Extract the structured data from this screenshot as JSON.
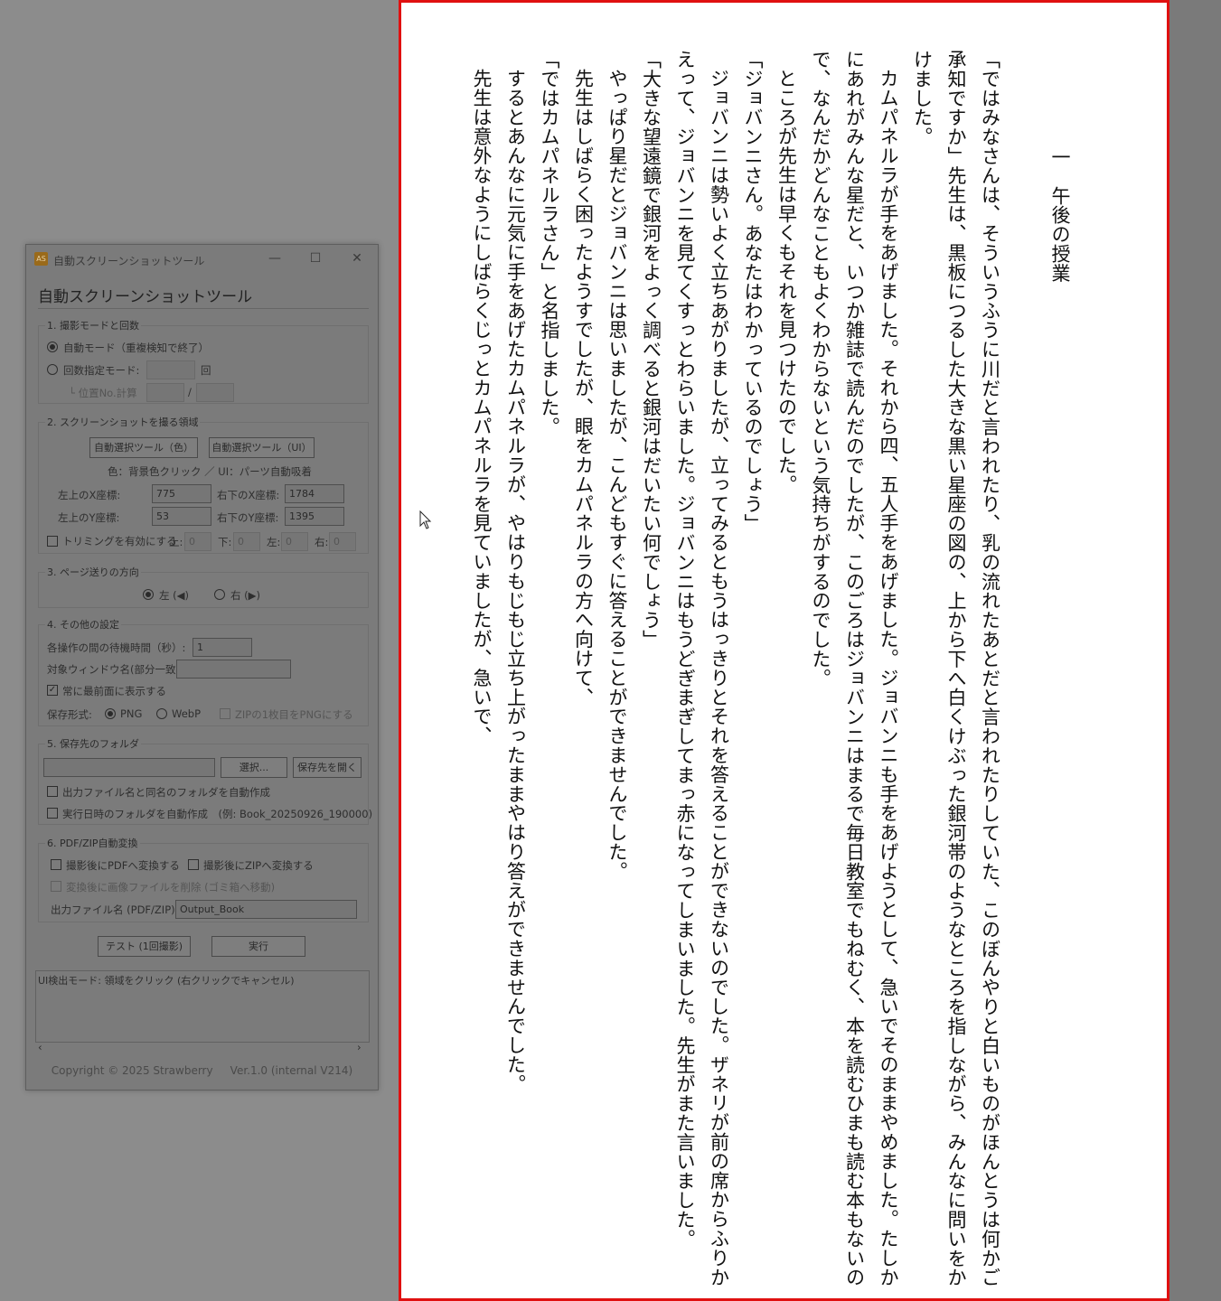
{
  "page": {
    "chapter_title": "一　午後の授業",
    "paragraphs": [
      "「ではみなさんは、そういうふうに川だと言われたり、乳の流れたあとだと言われたりしていた、このぼんやりと白いものがほんとうは何かご承知ですか」先生は、黒板につるした大きな黒い星座の図の、上から下へ白くけぶった銀河帯のようなところを指しながら、みんなに問いをかけました。",
      "カムパネルラが手をあげました。それから四、五人手をあげました。ジョバンニも手をあげようとして、急いでそのままやめました。たしかにあれがみんな星だと、いつか雑誌で読んだのでしたが、このごろはジョバンニはまるで毎日教室でもねむく、本を読むひまも読む本もないので、なんだかどんなこともよくわからないという気持ちがするのでした。",
      "ところが先生は早くもそれを見つけたのでした。",
      "「ジョバンニさん。あなたはわかっているのでしょう」",
      "ジョバンニは勢いよく立ちあがりましたが、立ってみるともうはっきりとそれを答えることができないのでした。ザネリが前の席からふりかえって、ジョバンニを見てくすっとわらいました。ジョバンニはもうどぎまぎしてまっ赤になってしまいました。先生がまた言いました。",
      "「大きな望遠鏡で銀河をよっく調べると銀河はだいたい何でしょう」",
      "やっぱり星だとジョバンニは思いましたが、こんどもすぐに答えることができませんでした。",
      "先生はしばらく困ったようすでしたが、眼をカムパネルラの方へ向けて、",
      "「ではカムパネルラさん」と名指しました。",
      "するとあんなに元気に手をあげたカムパネルラが、やはりもじもじ立ち上がったままやはり答えができませんでした。",
      "先生は意外なようにしばらくじっとカムパネルラを見ていましたが、急いで、"
    ]
  },
  "window": {
    "title": "自動スクリーンショットツール",
    "icon_text": "AS",
    "heading": "自動スクリーンショットツール",
    "minimize": "—",
    "maximize": "☐",
    "close": "✕",
    "sec1": {
      "title": "1. 撮影モードと回数",
      "auto_mode": "自動モード（重複検知で終了）",
      "count_mode": "回数指定モード:",
      "count_unit": "回",
      "pos_calc": "└ 位置No.計算",
      "slash": "/"
    },
    "sec2": {
      "title": "2. スクリーンショットを撮る領域",
      "btn_color": "自動選択ツール（色）",
      "btn_ui": "自動選択ツール（UI）",
      "hint": "色：背景色クリック ／ UI：パーツ自動吸着",
      "tl_x_label": "左上のX座標:",
      "tl_x": "775",
      "br_x_label": "右下のX座標:",
      "br_x": "1784",
      "tl_y_label": "左上のY座標:",
      "tl_y": "53",
      "br_y_label": "右下のY座標:",
      "br_y": "1395",
      "trim_label": "トリミングを有効にする",
      "top_label": "上:",
      "top": "0",
      "bottom_label": "下:",
      "bottom": "0",
      "left_label": "左:",
      "left": "0",
      "right_label": "右:",
      "right": "0"
    },
    "sec3": {
      "title": "3. ページ送りの方向",
      "left": "左 (◀)",
      "right": "右 (▶)"
    },
    "sec4": {
      "title": "4. その他の設定",
      "wait_label": "各操作の間の待機時間（秒）:",
      "wait": "1",
      "target_label": "対象ウィンドウ名(部分一致):",
      "target": "",
      "topmost": "常に最前面に表示する",
      "format_label": "保存形式:",
      "png": "PNG",
      "webp": "WebP",
      "zip_png": "ZIPの1枚目をPNGにする"
    },
    "sec5": {
      "title": "5. 保存先のフォルダ",
      "folder": "",
      "select": "選択...",
      "open": "保存先を開く",
      "same_name": "出力ファイル名と同名のフォルダを自動作成",
      "datetime": "実行日時のフォルダを自動作成　(例: Book_20250926_190000)"
    },
    "sec6": {
      "title": "6. PDF/ZIP自動変換",
      "to_pdf": "撮影後にPDFへ変換する",
      "to_zip": "撮影後にZIPへ変換する",
      "delete_images": "変換後に画像ファイルを削除 (ゴミ箱へ移動)",
      "output_label": "出力ファイル名 (PDF/ZIP):",
      "output": "Output_Book"
    },
    "test_button": "テスト (1回撮影)",
    "run_button": "実行",
    "log": "UI検出モード: 領域をクリック (右クリックでキャンセル)",
    "scroll_left": "‹",
    "scroll_right": "›",
    "copyright": "Copyright © 2025 Strawberry",
    "version": "Ver.1.0 (internal V214)"
  }
}
